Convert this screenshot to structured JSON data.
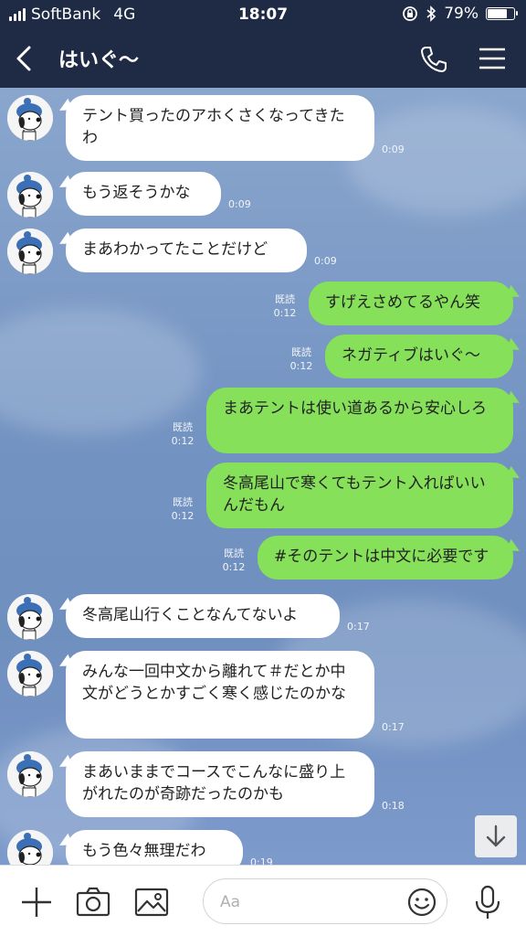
{
  "status": {
    "carrier": "SoftBank",
    "network": "4G",
    "time": "18:07",
    "battery": "79%",
    "battery_level": 0.79
  },
  "header": {
    "title": "はいぐ〜"
  },
  "messages": [
    {
      "side": "in",
      "text": "テント買ったのアホくさくなってきたわ",
      "time": "0:09"
    },
    {
      "side": "in",
      "text": "もう返そうかな",
      "time": "0:09"
    },
    {
      "side": "in",
      "text": "まあわかってたことだけど",
      "time": "0:09"
    },
    {
      "side": "out",
      "text": "すげえさめてるやん笑",
      "time": "0:12",
      "read": "既読"
    },
    {
      "side": "out",
      "text": "ネガティブはいぐ〜",
      "time": "0:12",
      "read": "既読"
    },
    {
      "side": "out",
      "text": "まあテントは使い道あるから安心しろ",
      "time": "0:12",
      "read": "既読"
    },
    {
      "side": "out",
      "text": "冬高尾山で寒くてもテント入ればいいんだもん",
      "time": "0:12",
      "read": "既読"
    },
    {
      "side": "out",
      "text": "#そのテントは中文に必要です",
      "time": "0:12",
      "read": "既読"
    },
    {
      "side": "in",
      "text": "冬高尾山行くことなんてないよ",
      "time": "0:17"
    },
    {
      "side": "in",
      "text": "みんな一回中文から離れて＃だとか中文がどうとかすごく寒く感じたのかな",
      "time": "0:17"
    },
    {
      "side": "in",
      "text": "まあいままでコースでこんなに盛り上がれたのが奇跡だったのかも",
      "time": "0:18"
    },
    {
      "side": "in",
      "text": "もう色々無理だわ",
      "time": "0:19"
    }
  ],
  "input": {
    "placeholder": "Aa"
  },
  "icons": {
    "back": "chevron-left-icon",
    "phone": "phone-icon",
    "menu": "hamburger-menu-icon",
    "plus": "plus-icon",
    "camera": "camera-icon",
    "image": "image-icon",
    "emoji": "smiley-icon",
    "mic": "microphone-icon",
    "scroll": "arrow-down-icon"
  },
  "colors": {
    "header_bg": "#1f2a44",
    "chat_bg": "#7a9bc8",
    "out_bubble": "#86e05a",
    "in_bubble": "#ffffff"
  }
}
